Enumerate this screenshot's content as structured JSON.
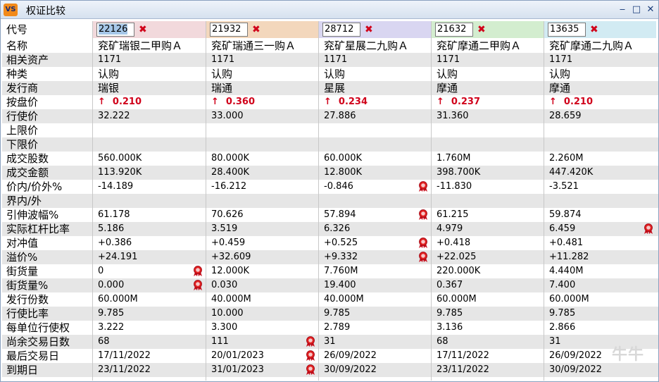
{
  "window": {
    "app_icon": "VS",
    "title": "权证比较",
    "buttons": [
      "‒",
      "□",
      "✕"
    ]
  },
  "header": {
    "label": "代号",
    "codes": [
      "22126",
      "21932",
      "28712",
      "21632",
      "13635"
    ],
    "colors": [
      "#f2d9dc",
      "#f3d7bc",
      "#d9d6f1",
      "#d3edcf",
      "#d2ebf3"
    ],
    "remove_icon": "✖"
  },
  "rows": [
    {
      "label": "名称",
      "values": [
        "兖矿瑞银二甲购Ａ",
        "兖矿瑞通三一购Ａ",
        "兖矿星展二九购Ａ",
        "兖矿摩通二甲购Ａ",
        "兖矿摩通二九购Ａ"
      ],
      "cn": true
    },
    {
      "label": "相关资产",
      "values": [
        "1171",
        "1171",
        "1171",
        "1171",
        "1171"
      ]
    },
    {
      "label": "种类",
      "values": [
        "认购",
        "认购",
        "认购",
        "认购",
        "认购"
      ],
      "cn": true
    },
    {
      "label": "发行商",
      "values": [
        "瑞银",
        "瑞通",
        "星展",
        "摩通",
        "摩通"
      ],
      "cn": true
    },
    {
      "label": "按盘价",
      "values": [
        "0.210",
        "0.360",
        "0.234",
        "0.237",
        "0.210"
      ],
      "up": true
    },
    {
      "label": "行使价",
      "values": [
        "32.222",
        "33.000",
        "27.886",
        "31.360",
        "28.659"
      ]
    },
    {
      "label": "上限价",
      "values": [
        "",
        "",
        "",
        "",
        ""
      ]
    },
    {
      "label": "下限价",
      "values": [
        "",
        "",
        "",
        "",
        ""
      ]
    },
    {
      "label": "成交股数",
      "values": [
        "560.000K",
        "80.000K",
        "60.000K",
        "1.760M",
        "2.260M"
      ]
    },
    {
      "label": "成交金额",
      "values": [
        "113.920K",
        "28.400K",
        "12.800K",
        "398.700K",
        "447.420K"
      ]
    },
    {
      "label": "价内/价外%",
      "values": [
        "-14.189",
        "-16.212",
        "-0.846",
        "-11.830",
        "-3.521"
      ],
      "medal": [
        2
      ]
    },
    {
      "label": "界内/外",
      "values": [
        "",
        "",
        "",
        "",
        ""
      ]
    },
    {
      "label": "引伸波幅%",
      "values": [
        "61.178",
        "70.626",
        "57.894",
        "61.215",
        "59.874"
      ],
      "medal": [
        2
      ]
    },
    {
      "label": "实际杠杆比率",
      "values": [
        "5.186",
        "3.519",
        "6.326",
        "4.979",
        "6.459"
      ],
      "medal": [
        4
      ]
    },
    {
      "label": "对冲值",
      "values": [
        "+0.386",
        "+0.459",
        "+0.525",
        "+0.418",
        "+0.481"
      ],
      "medal": [
        2
      ]
    },
    {
      "label": "溢价%",
      "values": [
        "+24.191",
        "+32.609",
        "+9.332",
        "+22.025",
        "+11.282"
      ],
      "medal": [
        2
      ]
    },
    {
      "label": "街货量",
      "values": [
        "0",
        "12.000K",
        "7.760M",
        "220.000K",
        "4.440M"
      ],
      "medal": [
        0
      ]
    },
    {
      "label": "街货量%",
      "values": [
        "0.000",
        "0.030",
        "19.400",
        "0.367",
        "7.400"
      ],
      "medal": [
        0
      ]
    },
    {
      "label": "发行份数",
      "values": [
        "60.000M",
        "40.000M",
        "40.000M",
        "60.000M",
        "60.000M"
      ]
    },
    {
      "label": "行使比率",
      "values": [
        "9.785",
        "10.000",
        "9.785",
        "9.785",
        "9.785"
      ]
    },
    {
      "label": "每单位行使权",
      "values": [
        "3.222",
        "3.300",
        "2.789",
        "3.136",
        "2.866"
      ]
    },
    {
      "label": "尚余交易日数",
      "values": [
        "68",
        "111",
        "31",
        "68",
        "31"
      ],
      "medal": [
        1
      ]
    },
    {
      "label": "最后交易日",
      "values": [
        "17/11/2022",
        "20/01/2023",
        "26/09/2022",
        "17/11/2022",
        "26/09/2022"
      ],
      "medal": [
        1
      ]
    },
    {
      "label": "到期日",
      "values": [
        "23/11/2022",
        "31/01/2023",
        "30/09/2022",
        "23/11/2022",
        "30/09/2022"
      ],
      "medal": [
        1
      ]
    }
  ],
  "icons": {
    "up": "up-arrow-icon",
    "medal": "medal-icon"
  },
  "watermark": "牛牛"
}
